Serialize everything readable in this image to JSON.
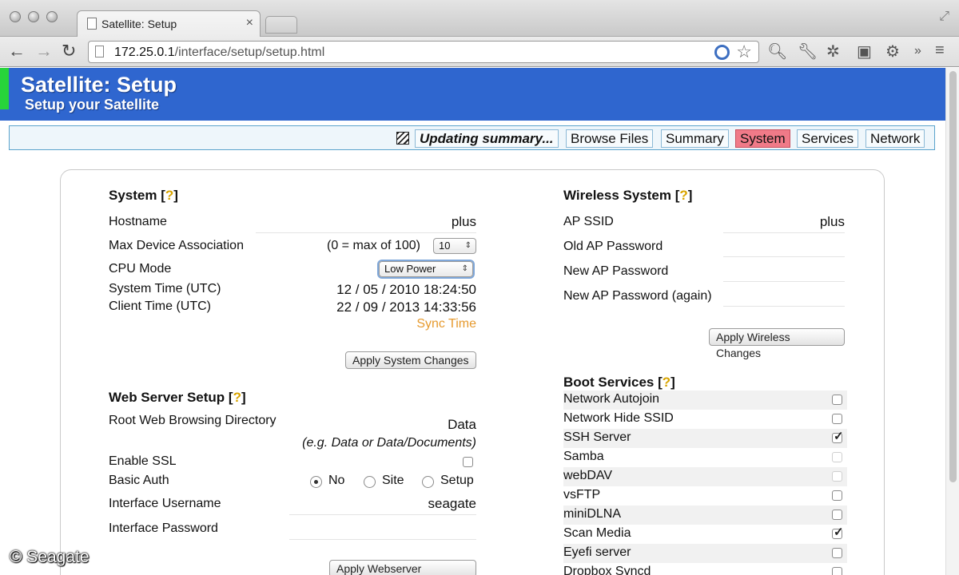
{
  "browser": {
    "tab_title": "Satellite: Setup",
    "tab_close": "×",
    "url_host": "172.25.0.1",
    "url_path": "/interface/setup/setup.html",
    "back": "←",
    "forward": "→",
    "reload": "↻",
    "ext_more": "»"
  },
  "header": {
    "title": "Satellite: Setup",
    "subtitle": "Setup your Satellite",
    "colors": {
      "header_bg": "#2f66cf",
      "accent_green": "#27d43a"
    }
  },
  "nav": {
    "status": "Updating summary...",
    "items": [
      "Browse Files",
      "Summary",
      "System",
      "Services",
      "Network"
    ],
    "active": "System",
    "active_color": "#f07a88"
  },
  "system": {
    "title": "System [",
    "help": "?",
    "close": "]",
    "hostname_label": "Hostname",
    "hostname_value": "plus",
    "max_assoc_label": "Max Device Association",
    "max_assoc_hint": "(0 = max of 100)",
    "max_assoc_value": "10",
    "cpu_label": "CPU Mode",
    "cpu_value": "Low Power",
    "system_time_label": "System Time (UTC)",
    "system_time_value": "12 / 05 / 2010 18:24:50",
    "client_time_label": "Client Time (UTC)",
    "client_time_value": "22 / 09 / 2013 14:33:56",
    "sync_time": "Sync Time",
    "apply": "Apply System Changes"
  },
  "webserver": {
    "title": "Web Server Setup [",
    "help": "?",
    "close": "]",
    "root_label": "Root Web Browsing Directory",
    "root_value": "Data",
    "root_hint": "(e.g. Data or Data/Documents)",
    "ssl_label": "Enable SSL",
    "auth_label": "Basic Auth",
    "auth_options": [
      "No",
      "Site",
      "Setup"
    ],
    "auth_selected": "No",
    "user_label": "Interface Username",
    "user_value": "seagate",
    "pass_label": "Interface Password",
    "apply": "Apply Webserver Changes"
  },
  "wireless": {
    "title": "Wireless System [",
    "help": "?",
    "close": "]",
    "ssid_label": "AP SSID",
    "ssid_value": "plus",
    "old_pw_label": "Old AP Password",
    "new_pw_label": "New AP Password",
    "new_pw2_label": "New AP Password (again)",
    "apply": "Apply Wireless Changes"
  },
  "boot": {
    "title": "Boot Services [",
    "help": "?",
    "close": "]",
    "services": [
      {
        "name": "Network Autojoin",
        "checked": false,
        "disabled": false
      },
      {
        "name": "Network Hide SSID",
        "checked": false,
        "disabled": false
      },
      {
        "name": "SSH Server",
        "checked": true,
        "disabled": false
      },
      {
        "name": "Samba",
        "checked": false,
        "disabled": true
      },
      {
        "name": "webDAV",
        "checked": false,
        "disabled": true
      },
      {
        "name": "vsFTP",
        "checked": false,
        "disabled": false
      },
      {
        "name": "miniDLNA",
        "checked": false,
        "disabled": false
      },
      {
        "name": "Scan Media",
        "checked": true,
        "disabled": false
      },
      {
        "name": "Eyefi server",
        "checked": false,
        "disabled": false
      },
      {
        "name": "Dropbox Syncd",
        "checked": false,
        "disabled": false
      }
    ]
  },
  "watermark": "© Seagate"
}
